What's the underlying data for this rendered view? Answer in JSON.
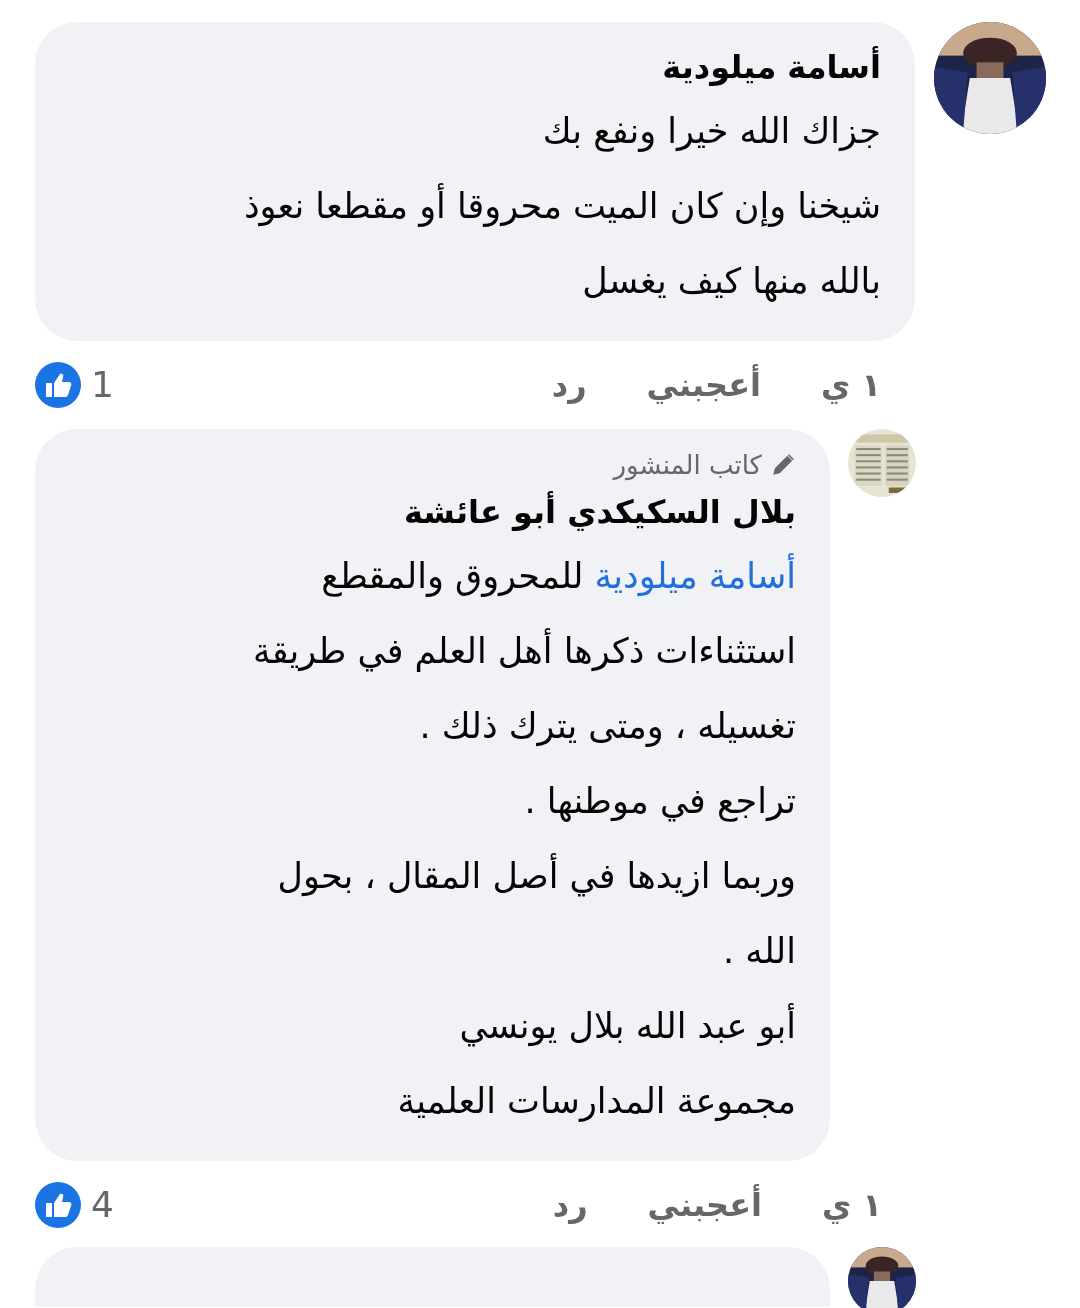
{
  "comments": [
    {
      "kind": "comment",
      "author": "أسامة ميلودية",
      "lines": [
        {
          "kind": "text",
          "text": "جزاك الله خيرا ونفع بك"
        },
        {
          "kind": "text",
          "text": "شيخنا وإن كان الميت محروقا أو مقطعا نعوذ"
        },
        {
          "kind": "text",
          "text": "بالله منها كيف يغسل"
        }
      ],
      "time": "١ ي",
      "like": "أعجبني",
      "reply": "رد",
      "like_count": "1"
    },
    {
      "kind": "reply",
      "badge": "كاتب المنشور",
      "author": "بلال السكيكدي أبو عائشة",
      "lines": [
        {
          "kind": "mention",
          "mention": "أسامة ميلودية",
          "text": "للمحروق والمقطع"
        },
        {
          "kind": "text",
          "text": "استثناءات ذكرها أهل العلم في طريقة"
        },
        {
          "kind": "text",
          "text": "تغسيله ، ومتى يترك ذلك ."
        },
        {
          "kind": "text",
          "text": "تراجع في موطنها ."
        },
        {
          "kind": "text",
          "text": "وربما ازيدها في أصل المقال ، بحول"
        },
        {
          "kind": "text",
          "text": "الله ."
        },
        {
          "kind": "text",
          "text": "أبو عبد الله بلال يونسي"
        },
        {
          "kind": "text",
          "text": "مجموعة المدارسات العلمية"
        }
      ],
      "time": "١ ي",
      "like": "أعجبني",
      "reply": "رد",
      "like_count": "4"
    }
  ]
}
